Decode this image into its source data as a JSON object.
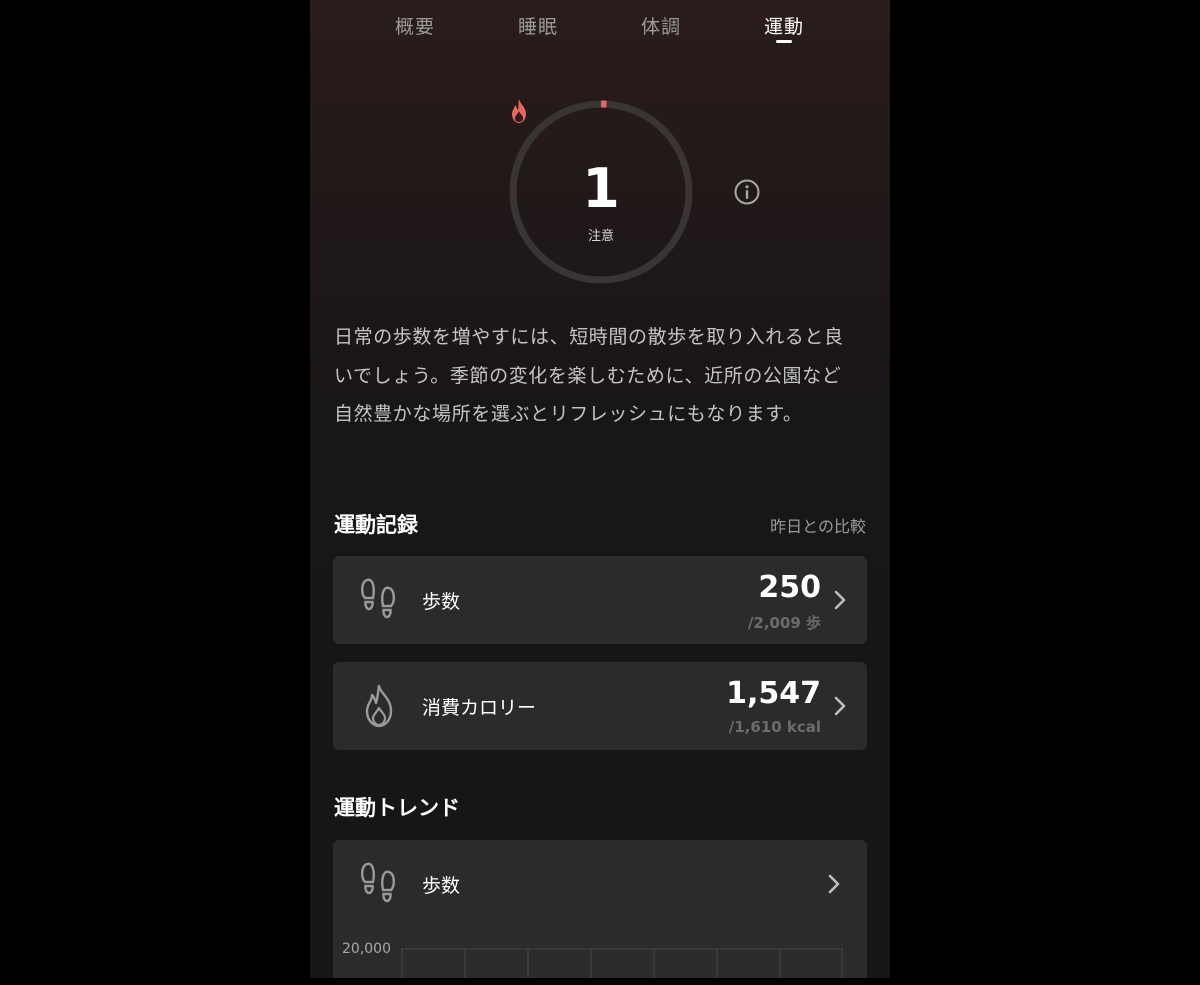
{
  "tabs": [
    {
      "label": "概要"
    },
    {
      "label": "睡眠"
    },
    {
      "label": "体調"
    },
    {
      "label": "運動"
    }
  ],
  "active_tab": "運動",
  "score": {
    "value": "1",
    "label": "注意",
    "progress": 0.01,
    "accent_color": "#e8675e",
    "icon": "fire-icon"
  },
  "info_icon": "info-icon",
  "advice": {
    "text": "日常の歩数を増やすには、短時間の散歩を取り入れると良いでしょう。季節の変化を楽しむために、近所の公園など自然豊かな場所を選ぶとリフレッシュにもなります。"
  },
  "records": {
    "title": "運動記録",
    "comparison": "昨日との比較",
    "items": [
      {
        "icon": "footprints-icon",
        "label": "歩数",
        "value": "250",
        "target": "/2,009 歩"
      },
      {
        "icon": "flame-icon",
        "label": "消費カロリー",
        "value": "1,547",
        "target": "/1,610 kcal"
      }
    ]
  },
  "trend": {
    "title": "運動トレンド",
    "item": {
      "icon": "footprints-icon",
      "label": "歩数"
    },
    "y_axis_top": "20,000"
  },
  "colors": {
    "background": "#000000",
    "card": "#2b2b2b",
    "accent": "#e8675e",
    "muted_text": "#9a9a9a"
  }
}
